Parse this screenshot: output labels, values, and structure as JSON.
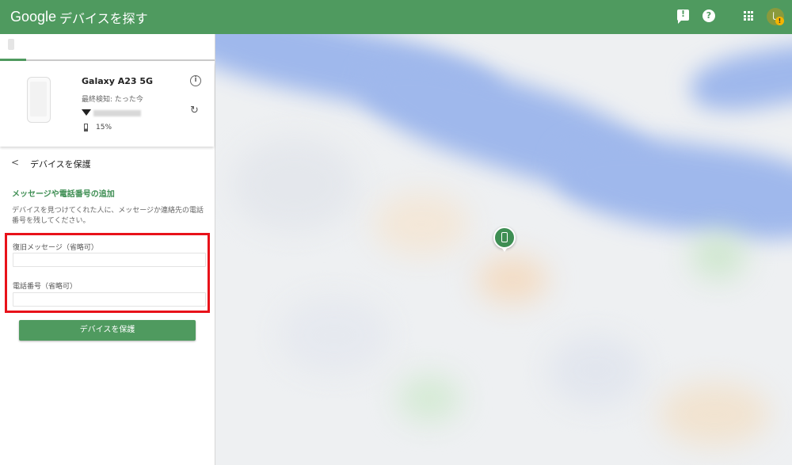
{
  "header": {
    "brand_google": "Google",
    "brand_product": "デバイスを探す",
    "avatar_initial": "し",
    "avatar_badge": "!"
  },
  "device": {
    "name": "Galaxy A23 5G",
    "last_seen": "最終検知: たった今",
    "battery": "15%"
  },
  "section": {
    "back_label": "<",
    "title": "デバイスを保護"
  },
  "form": {
    "heading": "メッセージや電話番号の追加",
    "description": "デバイスを見つけてくれた人に、メッセージか連絡先の電話番号を残してください。",
    "recovery_message_label": "復旧メッセージ（省略可）",
    "recovery_message_value": "",
    "phone_label": "電話番号（省略可）",
    "phone_value": "",
    "submit_label": "デバイスを保護"
  },
  "colors": {
    "brand_green": "#4f9a5f",
    "highlight_red": "#e8121a"
  }
}
